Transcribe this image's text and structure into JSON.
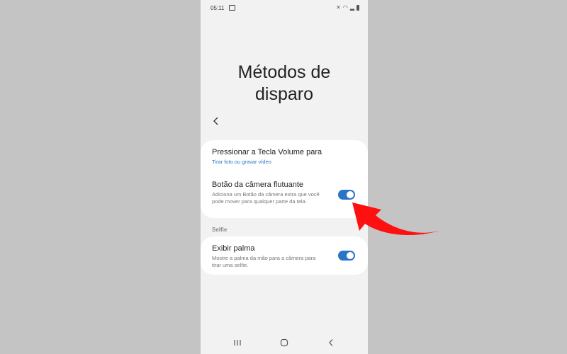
{
  "status_bar": {
    "time": "05:11"
  },
  "header": {
    "title_line1": "Métodos de",
    "title_line2": "disparo"
  },
  "settings_card": {
    "volume_key": {
      "title": "Pressionar a Tecla Volume para",
      "value": "Tirar foto ou gravar vídeo"
    },
    "floating_button": {
      "title": "Botão da câmera flutuante",
      "description": "Adiciona um Botão da câmera extra que você pode mover para qualquer parte da tela.",
      "enabled": true
    }
  },
  "selfie_section": {
    "header": "Selfie",
    "show_palm": {
      "title": "Exibir palma",
      "description": "Mostre a palma da mão para a câmera para tirar uma selfie.",
      "enabled": true
    }
  },
  "colors": {
    "accent": "#2a74c5",
    "annotation_arrow": "#ff1010",
    "page_bg": "#f2f2f2",
    "outer_bg": "#c4c4c4"
  },
  "icons": {
    "back": "chevron-left-icon",
    "recents": "recent-apps-icon",
    "home": "home-icon",
    "nav_back": "nav-back-icon",
    "annotation": "red-arrow-icon"
  }
}
